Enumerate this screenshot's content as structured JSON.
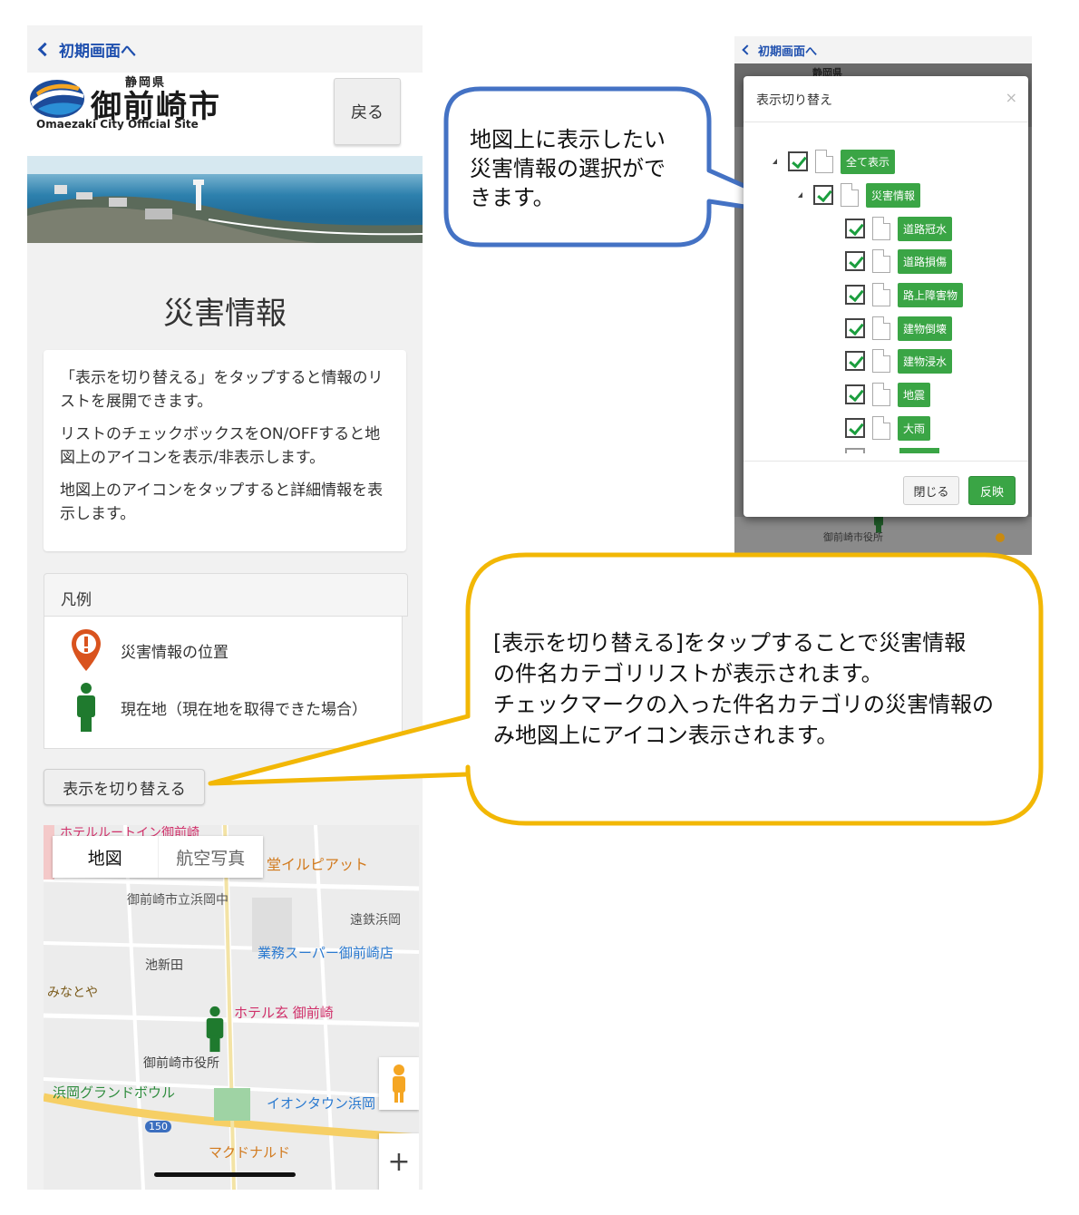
{
  "left_phone": {
    "back_label": "初期画面へ",
    "logo": {
      "prefecture": "静岡県",
      "city": "御前崎市",
      "subtitle": "Omaezaki City Official Site"
    },
    "back_button": "戻る",
    "page_title": "災害情報",
    "info_paragraphs": [
      "「表示を切り替える」をタップすると情報のリストを展開できます。",
      "リストのチェックボックスをON/OFFすると地図上のアイコンを表示/非表示します。",
      "地図上のアイコンをタップすると詳細情報を表示します。"
    ],
    "legend": {
      "title": "凡例",
      "items": [
        {
          "icon": "warning-pin-icon",
          "label": "災害情報の位置"
        },
        {
          "icon": "person-icon",
          "label": "現在地（現在地を取得できた場合）"
        }
      ]
    },
    "toggle_button": "表示を切り替える",
    "map": {
      "tabs": [
        "地図",
        "航空写真"
      ],
      "labels": [
        "ホテルルートイン御前崎",
        "堂イルピアット",
        "御前崎市立浜岡中",
        "遠鉄浜岡",
        "業務スーパー御前崎店",
        "池新田",
        "みなとや",
        "ホテル玄 御前崎",
        "御前崎市役所",
        "浜岡グランドボウル",
        "イオンタウン浜岡",
        "150",
        "マクドナルド"
      ],
      "zoom_in": "+"
    }
  },
  "right_phone": {
    "back_label": "初期画面へ",
    "prefecture_partial": "静岡県",
    "modal": {
      "title": "表示切り替え",
      "close": "×",
      "tree": [
        {
          "label": "全て表示",
          "level": 0,
          "expanded": true
        },
        {
          "label": "災害情報",
          "level": 1,
          "expanded": true
        },
        {
          "label": "道路冠水",
          "level": 2
        },
        {
          "label": "道路損傷",
          "level": 2
        },
        {
          "label": "路上障害物",
          "level": 2
        },
        {
          "label": "建物倒壊",
          "level": 2
        },
        {
          "label": "建物浸水",
          "level": 2
        },
        {
          "label": "地震",
          "level": 2
        },
        {
          "label": "大雨",
          "level": 2
        }
      ],
      "close_button": "閉じる",
      "apply_button": "反映"
    },
    "map_label": "御前崎市役所"
  },
  "callouts": {
    "blue": [
      "地図上に表示したい",
      "災害情報の選択がで",
      "きます。"
    ],
    "yellow": [
      "[表示を切り替える]をタップすることで災害情報",
      "の件名カテゴリリストが表示されます。",
      "チェックマークの入った件名カテゴリの災害情報の",
      "み地図上にアイコン表示されます。"
    ]
  },
  "colors": {
    "link_blue": "#1e4fae",
    "green_tag": "#3aa545",
    "callout_blue": "#4472c4",
    "callout_yellow": "#f2b705"
  }
}
